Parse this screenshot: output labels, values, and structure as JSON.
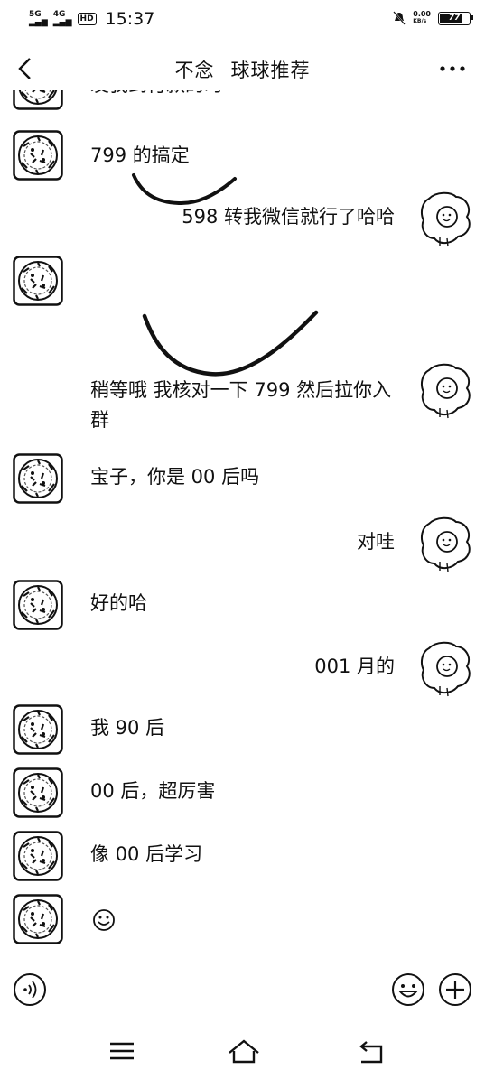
{
  "status": {
    "net1": "5G",
    "net2": "4G",
    "hd": "HD",
    "time": "15:37",
    "speed": "0.00",
    "speed_unit": "KB/s",
    "battery": "77",
    "battery_level": 0.77
  },
  "header": {
    "contact_name": "不念",
    "group_name": "球球推荐"
  },
  "messages": [
    {
      "side": "left",
      "text": "发我到付款的时",
      "partial": true
    },
    {
      "side": "left",
      "text": "799 的搞定"
    },
    {
      "side": "right",
      "text": "598 转我微信就行了哈哈"
    },
    {
      "side": "left",
      "text": ""
    },
    {
      "side": "right",
      "text": "稍等哦  我核对一下 799 然后拉你入群"
    },
    {
      "side": "left",
      "text": "宝子，你是 00 后吗"
    },
    {
      "side": "right",
      "text": "对哇"
    },
    {
      "side": "left",
      "text": "好的哈"
    },
    {
      "side": "right",
      "text": "001 月的"
    },
    {
      "side": "left",
      "text": "我 90 后"
    },
    {
      "side": "left",
      "text": "00 后，超厉害"
    },
    {
      "side": "left",
      "text": "像 00 后学习"
    },
    {
      "side": "left",
      "text": "",
      "emoji": "smile-emoji"
    }
  ],
  "icons": {
    "back": "back-arrow-icon",
    "more": "more-icon",
    "voice": "voice-icon",
    "emoji": "emoji-icon",
    "plus": "plus-icon",
    "nav_menu": "menu-icon",
    "nav_home": "home-icon",
    "nav_back": "back-icon"
  }
}
